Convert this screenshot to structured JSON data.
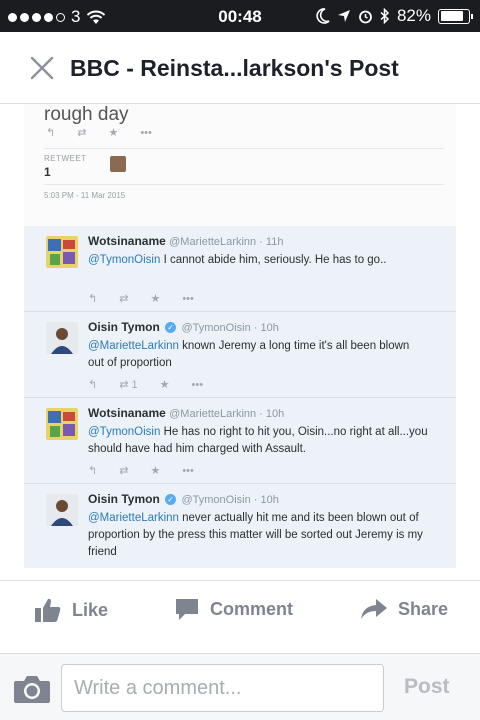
{
  "status_bar": {
    "carrier": "3",
    "time": "00:48",
    "battery": "82%",
    "battery_level": 0.82
  },
  "header": {
    "title": "BBC - Reinsta...larkson's Post"
  },
  "photo": {
    "top_tweet_text": "rough day",
    "retweet_label": "RETWEET",
    "retweet_count": "1",
    "date": "5:03 PM - 11 Mar 2015",
    "tweets": [
      {
        "name": "Wotsinaname",
        "handle": "@MarietteLarkinn · 11h",
        "mention": "@TymonOisin",
        "text": " I cannot abide him, seriously. He has to go..",
        "retweets": "",
        "verified": false
      },
      {
        "name": "Oisin Tymon",
        "handle": "@TymonOisin · 10h",
        "mention": "@MarietteLarkinn",
        "text": " known Jeremy a long time it's all been blown out of proportion",
        "retweets": "1",
        "verified": true
      },
      {
        "name": "Wotsinaname",
        "handle": "@MarietteLarkinn · 10h",
        "mention": "@TymonOisin",
        "text": " He has no right to hit you, Oisin...no right at all...you should have had him charged with Assault.",
        "retweets": "",
        "verified": false
      },
      {
        "name": "Oisin Tymon",
        "handle": "@TymonOisin · 10h",
        "mention": "@MarietteLarkinn",
        "text": " never actually hit me and its been blown out of proportion by the press this matter will be sorted out Jeremy is my friend",
        "retweets": "",
        "verified": true
      }
    ]
  },
  "actions": {
    "like": "Like",
    "comment": "Comment",
    "share": "Share"
  },
  "comment_bar": {
    "placeholder": "Write a comment...",
    "post": "Post"
  },
  "colors": {
    "status_bar_bg": "#1a1c20",
    "action_gray": "#7f8590",
    "mention_blue": "#2b7bb9",
    "tweet_bg": "#edf2f8"
  }
}
